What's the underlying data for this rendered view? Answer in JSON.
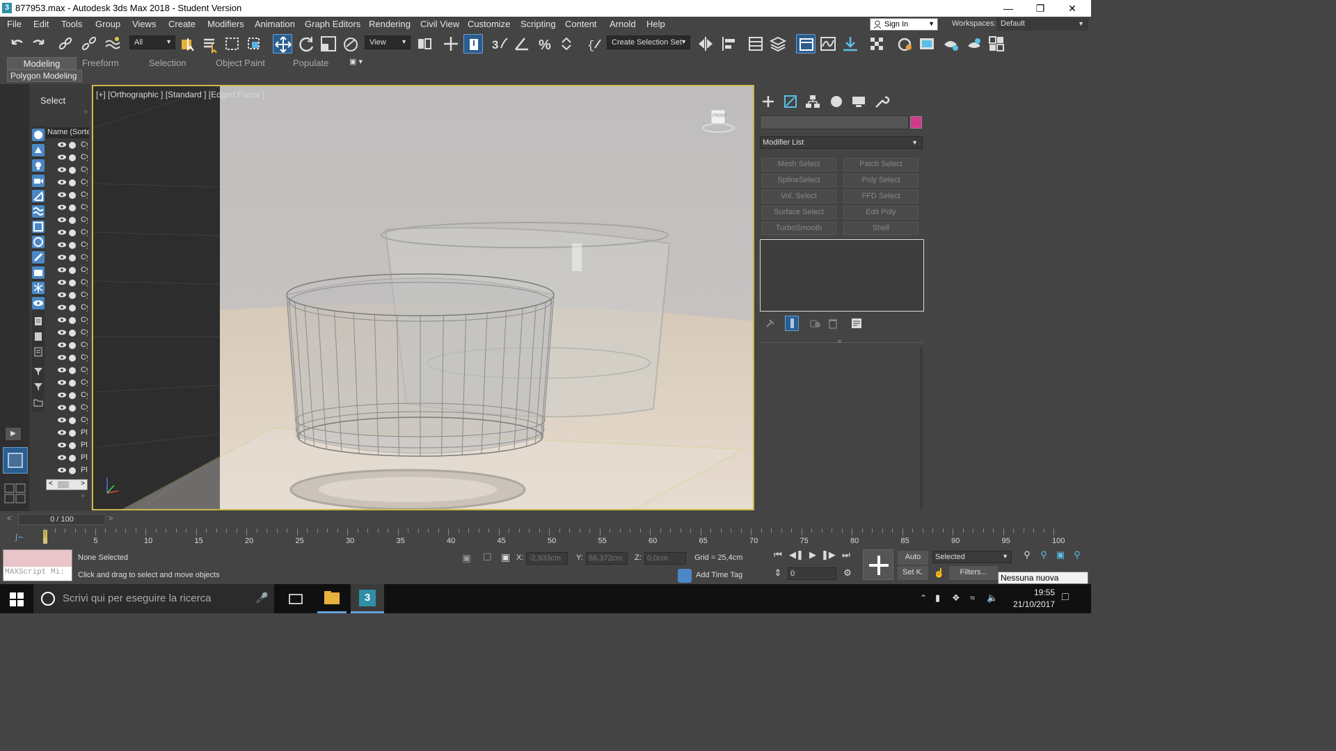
{
  "window": {
    "title": "877953.max - Autodesk 3ds Max 2018 - Student Version",
    "app_icon": "3"
  },
  "menu": [
    "File",
    "Edit",
    "Tools",
    "Group",
    "Views",
    "Create",
    "Modifiers",
    "Animation",
    "Graph Editors",
    "Rendering",
    "Civil View",
    "Customize",
    "Scripting",
    "Content",
    "Arnold",
    "Help"
  ],
  "account": {
    "signin": "Sign In",
    "workspaces_label": "Workspaces:",
    "workspace": "Default"
  },
  "toolbar": {
    "filter": "All",
    "refcoord": "View",
    "selection_set": "Create Selection Set"
  },
  "ribbon": {
    "tabs": [
      "Modeling",
      "Freeform",
      "Selection",
      "Object Paint",
      "Populate"
    ],
    "panel": "Polygon Modeling"
  },
  "explorer": {
    "select_label": "Select",
    "column": "Name (Sorte",
    "rows": [
      "Cy",
      "Cy",
      "Cy",
      "Cy",
      "Cy",
      "Cy",
      "Cy",
      "Cy",
      "Cy",
      "Cy",
      "Cy",
      "Cy",
      "Cy",
      "Cy",
      "Cy",
      "Cy",
      "Cy",
      "Cy",
      "Cy",
      "Cy",
      "Cy",
      "Cy",
      "Cy",
      "Pl",
      "Pl",
      "Pl",
      "Pl"
    ]
  },
  "viewport": {
    "label": "[+] [Orthographic ] [Standard ] [Edged Faces ]",
    "viewcube": "FRONT"
  },
  "command_panel": {
    "modifier_list": "Modifier List",
    "color": "#d13a8a",
    "buttons": [
      "Mesh Select",
      "Patch Select",
      "SplineSelect",
      "Poly Select",
      "Vol. Select",
      "FFD Select",
      "Surface Select",
      "Edit Poly",
      "TurboSmooth",
      "Shell"
    ]
  },
  "timeline": {
    "position": "0 / 100",
    "ticks": [
      "0",
      "5",
      "10",
      "15",
      "20",
      "25",
      "30",
      "35",
      "40",
      "45",
      "50",
      "55",
      "60",
      "65",
      "70",
      "75",
      "80",
      "85",
      "90",
      "95",
      "100"
    ]
  },
  "status": {
    "maxscript": "MAXScript Mi:",
    "selection": "None Selected",
    "prompt": "Click and drag to select and move objects",
    "x_label": "X:",
    "x": "-2,933cm",
    "y_label": "Y:",
    "y": "56,372cm",
    "z_label": "Z:",
    "z": "0,0cm",
    "grid": "Grid = 25,4cm",
    "add_time_tag": "Add Time Tag",
    "auto": "Auto",
    "setk": "Set K.",
    "key_mode": "Selected",
    "filters": "Filters...",
    "frame": "0"
  },
  "tooltip": "Nessuna nuova notifica",
  "taskbar": {
    "search": "Scrivi qui per eseguire la ricerca",
    "time": "19:55",
    "date": "21/10/2017"
  }
}
